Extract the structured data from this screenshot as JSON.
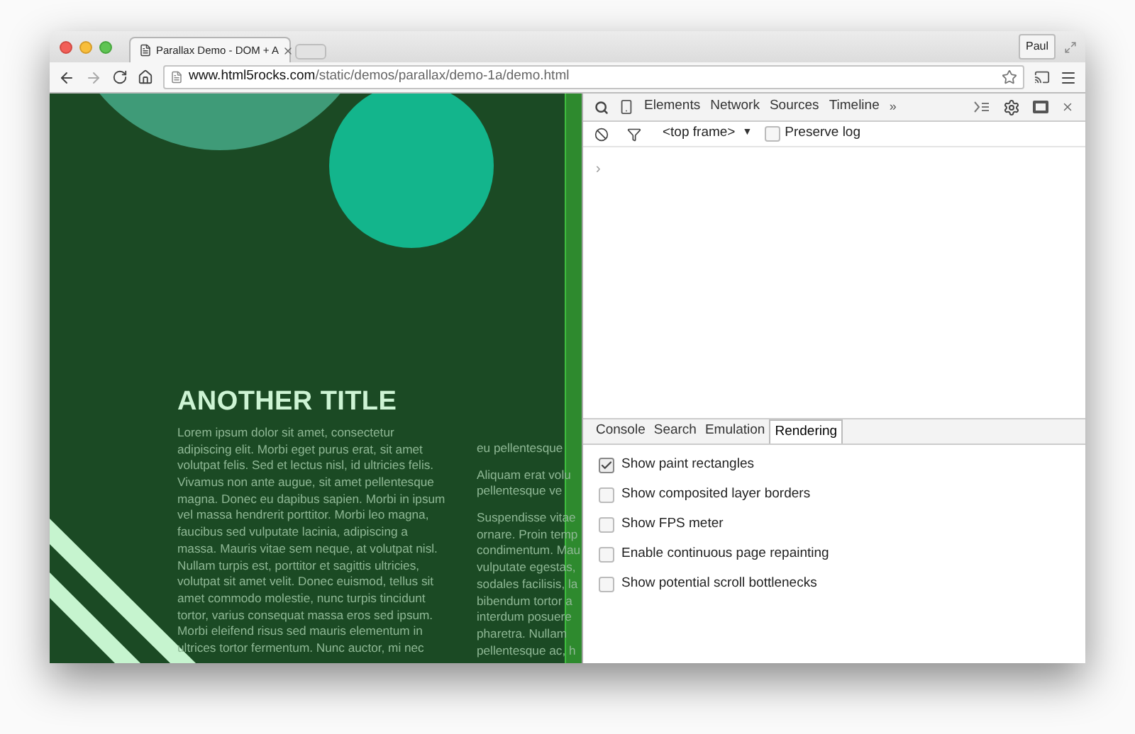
{
  "browser": {
    "tab": {
      "title": "Parallax Demo - DOM + A",
      "selected": true
    },
    "profile": "Paul",
    "url": {
      "host": "www.html5rocks.com",
      "path": "/static/demos/parallax/demo-1a/demo.html"
    }
  },
  "page": {
    "title": "ANOTHER TITLE",
    "column_1": [
      "Lorem ipsum dolor sit amet, consectetur",
      "adipiscing elit. Morbi eget purus erat, sit amet",
      "volutpat felis. Sed et lectus nisl, id ultricies felis.",
      "Vivamus non ante augue, sit amet pellentesque",
      "magna. Donec eu dapibus sapien. Morbi in ipsum",
      "vel massa hendrerit porttitor. Morbi leo magna,",
      "faucibus sed vulputate lacinia, adipiscing a",
      "massa. Mauris vitae sem neque, at volutpat nisl.",
      "Nullam turpis est, porttitor et sagittis ultricies,",
      "volutpat sit amet velit. Donec euismod, tellus sit",
      "amet commodo molestie, nunc turpis tincidunt",
      "tortor, varius consequat massa eros sed ipsum.",
      "Morbi eleifend risus sed mauris elementum in",
      "ultrices tortor fermentum. Nunc auctor, mi nec"
    ],
    "column_2": [
      [
        "eu pellentesque"
      ],
      [
        "Aliquam erat volu",
        "pellentesque ve"
      ],
      [
        "Suspendisse vitae",
        "ornare. Proin temp",
        "condimentum. Mau",
        "vulputate egestas,",
        "sodales facilisis, la",
        "bibendum tortor a",
        "interdum posuere",
        "pharetra. Nullam",
        "pellentesque ac, h"
      ]
    ]
  },
  "devtools": {
    "panels": [
      {
        "label": "Elements",
        "selected": false
      },
      {
        "label": "Network",
        "selected": false
      },
      {
        "label": "Sources",
        "selected": false
      },
      {
        "label": "Timeline",
        "selected": false
      }
    ],
    "more": "»",
    "frame_select": "<top frame>",
    "frame_arrow": "▼",
    "preserve_log": {
      "label": "Preserve log",
      "checked": false
    },
    "prompt": "›",
    "drawer_tabs": [
      {
        "label": "Console",
        "selected": false
      },
      {
        "label": "Search",
        "selected": false
      },
      {
        "label": "Emulation",
        "selected": false
      },
      {
        "label": "Rendering",
        "selected": true
      }
    ],
    "rendering_options": [
      {
        "label": "Show paint rectangles",
        "checked": true
      },
      {
        "label": "Show composited layer borders",
        "checked": false
      },
      {
        "label": "Show FPS meter",
        "checked": false
      },
      {
        "label": "Enable continuous page repainting",
        "checked": false
      },
      {
        "label": "Show potential scroll bottlenecks",
        "checked": false
      }
    ]
  }
}
